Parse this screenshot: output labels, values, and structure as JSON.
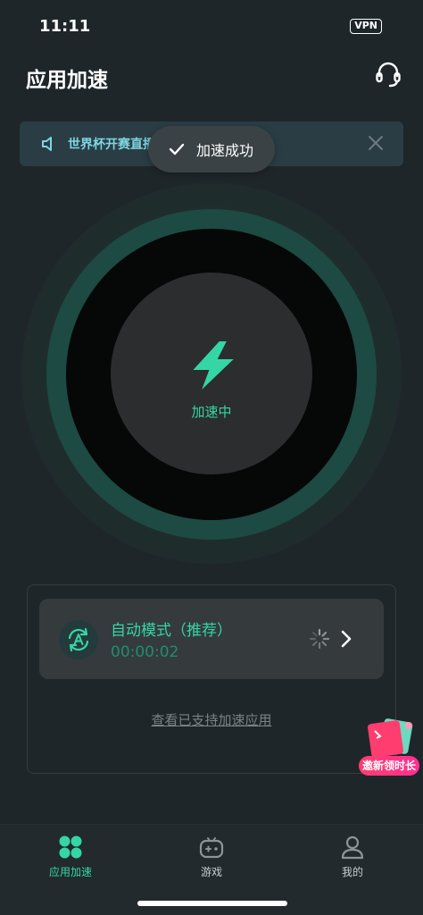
{
  "status_bar": {
    "time": "11:11",
    "vpn": "VPN"
  },
  "header": {
    "title": "应用加速"
  },
  "notice": {
    "text": "世界杯开赛直播 …",
    "visible_text_tail": "…"
  },
  "toast": {
    "text": "加速成功"
  },
  "accelerator": {
    "status": "加速中"
  },
  "mode_card": {
    "title": "自动模式（推荐）",
    "timer": "00:00:02"
  },
  "support_link": "查看已支持加速应用",
  "invite_badge": {
    "label": "邀新领时长"
  },
  "bottom_nav": {
    "items": [
      {
        "label": "应用加速",
        "active": true
      },
      {
        "label": "游戏",
        "active": false
      },
      {
        "label": "我的",
        "active": false
      }
    ]
  },
  "colors": {
    "accent": "#35d6a5",
    "notice_text": "#7fd6e0",
    "background": "#1f262a",
    "invite": "#ff3d6e"
  },
  "icons": {
    "support": "headset-icon",
    "notice": "speaker-icon",
    "close": "close-icon",
    "toast": "check-icon",
    "status": "lightning-bolt-icon",
    "mode": "auto-mode-icon",
    "loading": "spinner-icon",
    "chevron": "chevron-right-icon",
    "nav_accel": "grid-icon",
    "nav_games": "gamepad-icon",
    "nav_me": "user-icon"
  }
}
